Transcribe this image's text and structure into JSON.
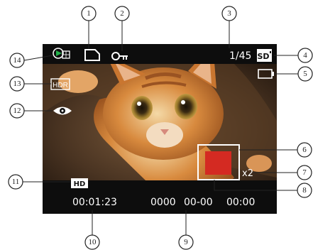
{
  "screen": {
    "image_count": "1/45",
    "sd_label": "SD",
    "hdr_label": "HDR",
    "hd_label": "HD",
    "zoom": "x2",
    "elapsed_time": "00:01:23",
    "date_year": "0000",
    "date_month_day": "00-00",
    "time": "00:00"
  },
  "callouts": [
    "1",
    "2",
    "3",
    "4",
    "5",
    "6",
    "7",
    "8",
    "9",
    "10",
    "11",
    "12",
    "13",
    "14"
  ],
  "colors": {
    "status_bar": "#0d0d0d",
    "focus_box": "#d42a22",
    "photo_dark": "#2c2016",
    "kitten_orange": "#c9772e",
    "kitten_light": "#efd2a3"
  }
}
